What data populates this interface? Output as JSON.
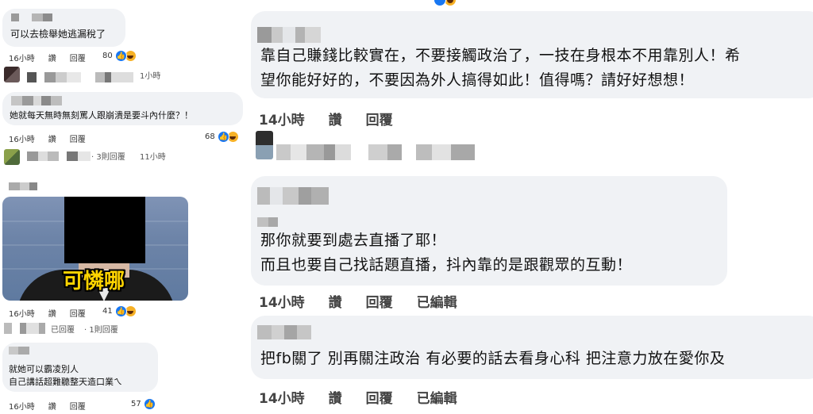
{
  "left": {
    "comment1": {
      "text": "可以去檢舉她逃漏稅了",
      "reactions": "80"
    },
    "reply1": {
      "time": "1小時"
    },
    "comment2": {
      "text": "她就每天無時無刻罵人跟崩潰是要斗內什麼？！",
      "reactions": "68"
    },
    "reply2": {
      "count_text": "· 3則回覆",
      "time": "11小時"
    },
    "comment3": {
      "caption": "可憐哪",
      "reactions": "41"
    },
    "reply3": {
      "reply_label": "已回覆",
      "count_text": "· 1則回覆"
    },
    "comment4": {
      "lines": [
        "就她可以霸凌別人",
        "自己講話超難聽整天造口業ㄟ"
      ],
      "reactions": "57"
    },
    "meta": {
      "time": "16小時",
      "like": "讚",
      "reply": "回覆"
    }
  },
  "right": {
    "comment1": {
      "lines": [
        "靠自己賺錢比較實在，不要接觸政治了，一技在身根本不用靠別人！希",
        "望你能好好的，不要因為外人搞得如此！值得嗎？請好好想想！"
      ],
      "time": "14小時",
      "like": "讚",
      "reply": "回覆"
    },
    "comment2": {
      "lines": [
        "那你就要到處去直播了耶！",
        "而且也要自己找話題直播，抖內靠的是跟觀眾的互動！"
      ],
      "time": "14小時",
      "like": "讚",
      "reply": "回覆",
      "edited": "已編輯"
    },
    "comment3": {
      "lines": [
        "把fb關了 別再關注政治 有必要的話去看身心科 把注意力放在愛你及"
      ],
      "time": "14小時",
      "like": "讚",
      "reply": "回覆",
      "edited": "已編輯"
    }
  },
  "icons": [
    "like-icon",
    "haha-icon"
  ],
  "colors": {
    "bubble": "#f0f2f5",
    "like_blue": "#1877f2",
    "haha_yellow": "#f7b125",
    "caption_yellow": "#ffd400"
  }
}
